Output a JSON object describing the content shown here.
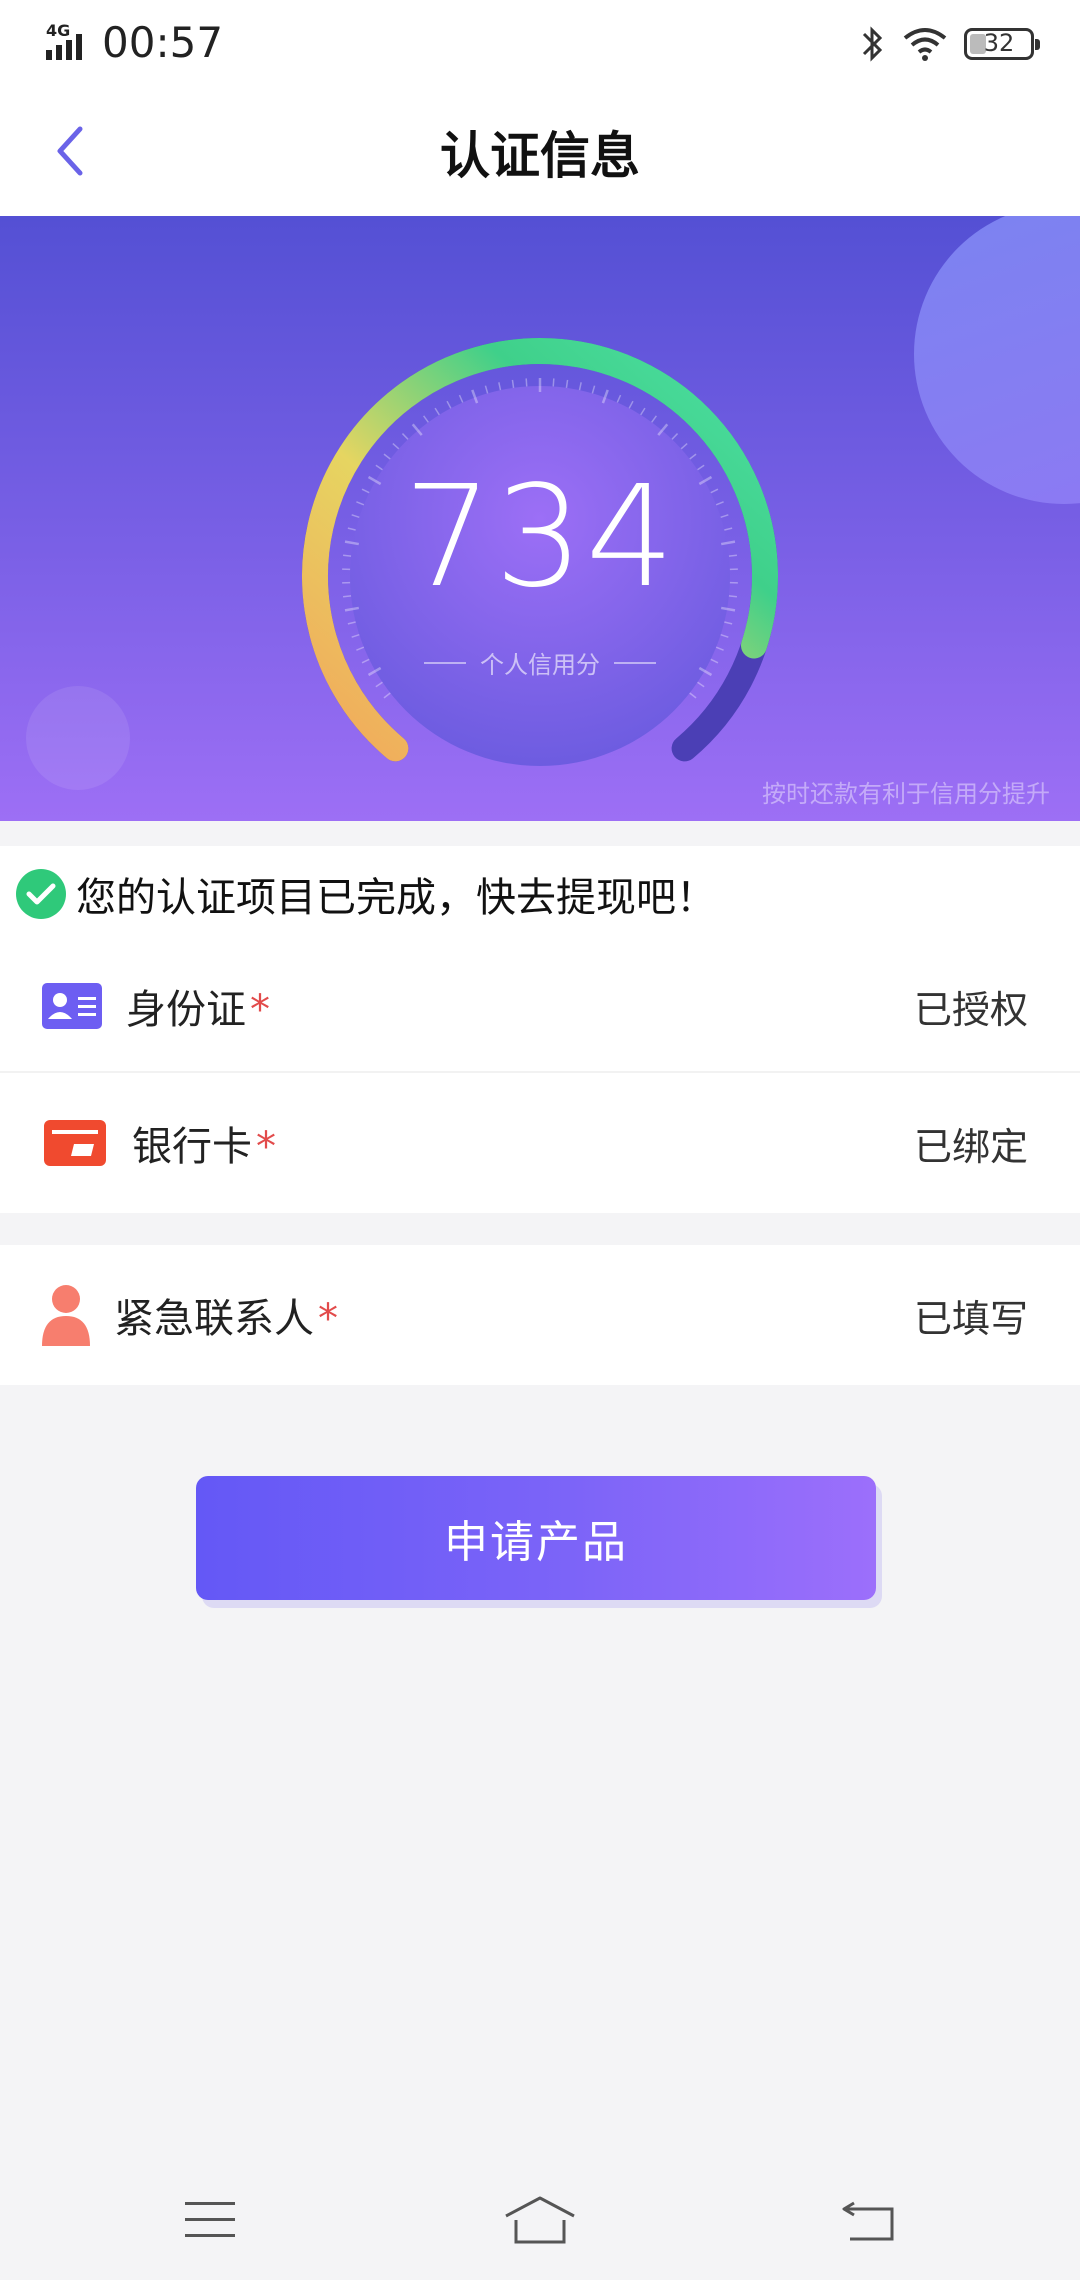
{
  "status_bar": {
    "network": "4G",
    "time": "00:57",
    "battery": "32"
  },
  "header": {
    "title": "认证信息"
  },
  "credit": {
    "score": "734",
    "label": "个人信用分",
    "hint": "按时还款有利于信用分提升",
    "gauge_colors": [
      "#f2a75b",
      "#e6d561",
      "#3fd08a",
      "#4ee0a3"
    ]
  },
  "notice": {
    "text": "您的认证项目已完成，快去提现吧！"
  },
  "auth_items": [
    {
      "label": "身份证",
      "required_mark": "*",
      "status": "已授权",
      "icon": "id-card-icon",
      "color": "#6d5ef2"
    },
    {
      "label": "银行卡",
      "required_mark": "*",
      "status": "已绑定",
      "icon": "bank-card-icon",
      "color": "#f04a2f"
    },
    {
      "label": "紧急联系人",
      "required_mark": "*",
      "status": "已填写",
      "icon": "contact-person-icon",
      "color": "#f77e6e"
    }
  ],
  "apply_button": {
    "label": "申请产品"
  },
  "nav": {
    "menu_icon": "menu-icon",
    "home_icon": "home-icon",
    "back_icon": "back-icon"
  }
}
